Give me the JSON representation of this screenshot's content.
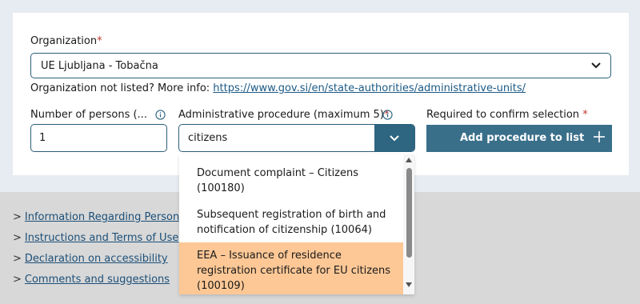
{
  "organization": {
    "label": "Organization",
    "required_mark": "*",
    "selected": "UE Ljubljana - Tobačna",
    "not_listed_text": "Organization not listed? More info: ",
    "info_link": "https://www.gov.si/en/state-authorities/administrative-units/"
  },
  "persons": {
    "label": "Number of persons (...",
    "value": "1"
  },
  "procedure": {
    "label": "Administrative procedure (maximum 5)",
    "required_mark": "*",
    "value": "citizens"
  },
  "confirm": {
    "label": "Required to confirm selection",
    "required_mark": "*",
    "button_label": "Add procedure to list"
  },
  "dropdown_options": [
    {
      "line1": "Document complaint – Citizens",
      "line2": "(100180)"
    },
    {
      "line1": "Subsequent registration of birth and",
      "line2": "notification of citizenship (10064)"
    },
    {
      "line1": "EEA – Issuance of residence",
      "line2": "registration certificate for EU citizens",
      "line3": "(100109)"
    }
  ],
  "footer_links": [
    "Information Regarding Personal",
    "Instructions and Terms of Use",
    "Declaration on accessibility",
    "Comments and suggestions"
  ],
  "colors": {
    "accent": "#2e6580",
    "highlight": "#fdc896",
    "required": "#c0392b"
  }
}
